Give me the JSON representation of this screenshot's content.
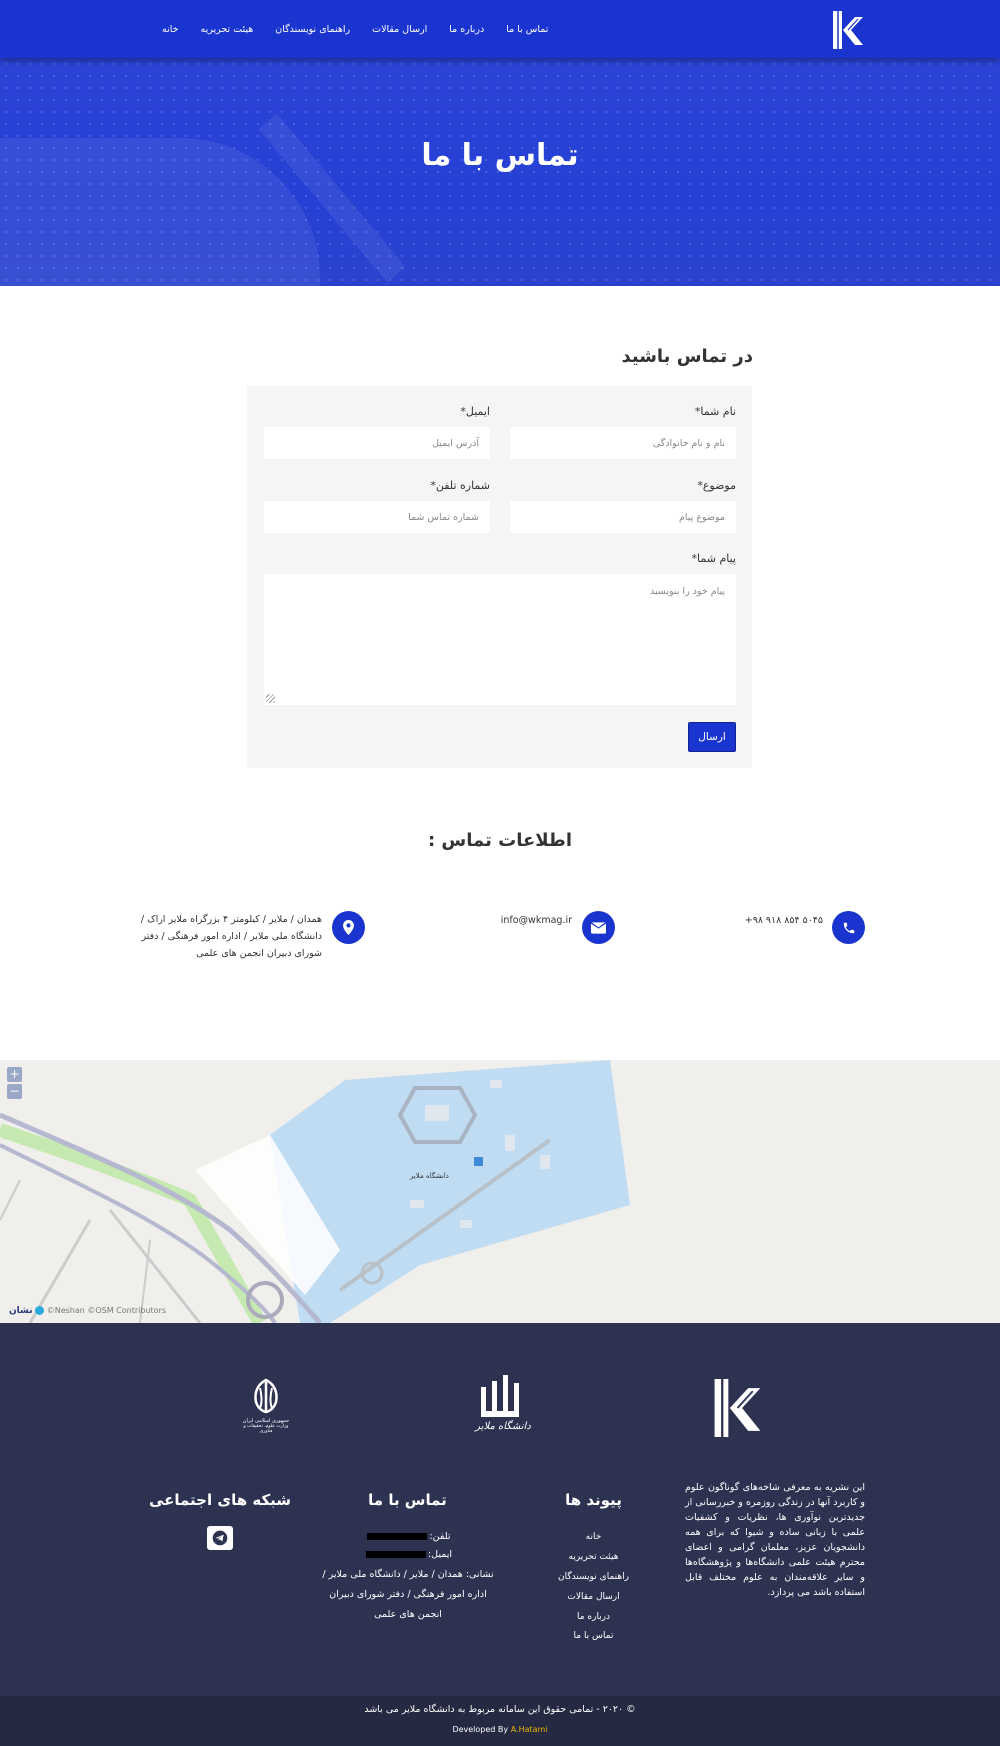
{
  "nav": {
    "items": [
      "خانه",
      "هیئت تحریریه",
      "راهنمای نویسندگان",
      "ارسال مقالات",
      "درباره ما",
      "تماس با ما"
    ]
  },
  "hero": {
    "title": "تماس با ما"
  },
  "form": {
    "heading": "در تماس باشید",
    "name_label": "نام شما*",
    "name_placeholder": "نام و نام خانوادگی",
    "email_label": "ایمیل*",
    "email_placeholder": "آدرس ایمیل",
    "subject_label": "موضوع*",
    "subject_placeholder": "موضوع پیام",
    "phone_label": "شماره تلفن*",
    "phone_placeholder": "شماره تماس شما",
    "message_label": "پیام شما*",
    "message_placeholder": "پیام خود را بنویسید",
    "submit_label": "ارسال"
  },
  "contact_info": {
    "heading": "اطلاعات تماس :",
    "phone": "+۹۸ ۹۱۸ ۸۵۴ ۵۰۴۵",
    "email": "info@wkmag.ir",
    "address": "همدان / ملایر / کیلومتر ۴ بزرگراه ملایر اراک / دانشگاه ملی ملایر / اداره امور فرهنگی / دفتر شورای دبیران انجمن های علمی"
  },
  "map": {
    "zoom_in": "+",
    "zoom_out": "−",
    "credit": "©Neshan ©OSM Contributors",
    "brand": "نشان",
    "place_label": "دانشگاه ملایر"
  },
  "footer": {
    "about": "این نشریه به معرفی شاخه‌های گوناگون علوم و کاربرد آنها در زندگی روزمره و خبررسانی از جدیدترین نوآوری ها، نظریات و کشفیات علمی با زبانی ساده و شیوا که برای همه دانشجویان عزیز، معلمان گرامی و اعضای محترم هیئت علمی دانشگاه‌ها و پژوهشگاه‌ها و سایر علاقه‌مندان به علوم مختلف قابل استفاده باشد می پردازد.",
    "links_heading": "پیوند ها",
    "links": [
      "خانه",
      "هیئت تحریریه",
      "راهنمای نویسندگان",
      "ارسال مقالات",
      "درباره ما",
      "تماس با ما"
    ],
    "contact_heading": "تماس با ما",
    "phone_label": "تلفن:",
    "email_label": "ایمیل:",
    "address": "نشانی: همدان / ملایر / دانشگاه ملی ملایر / اداره امور فرهنگی / دفتر شورای دبیران انجمن های علمی",
    "social_heading": "شبکه های اجتماعی",
    "university_logo_text": "دانشگاه ملایر",
    "ministry_logo_text": "جمهوری اسلامی ایران",
    "ministry_logo_subtext": "وزارت علوم، تحقیقات و فناوری",
    "copyright": "© ۲۰۲۰ - تمامی حقوق این سامانه مربوط به دانشگاه ملایر می باشد",
    "developed_by": "Developed By",
    "developer": "A.Hatami"
  },
  "colors": {
    "primary": "#1a35cf",
    "footer": "#2e3251",
    "copyright_bar": "#252941",
    "developer_accent": "#e8b300"
  }
}
